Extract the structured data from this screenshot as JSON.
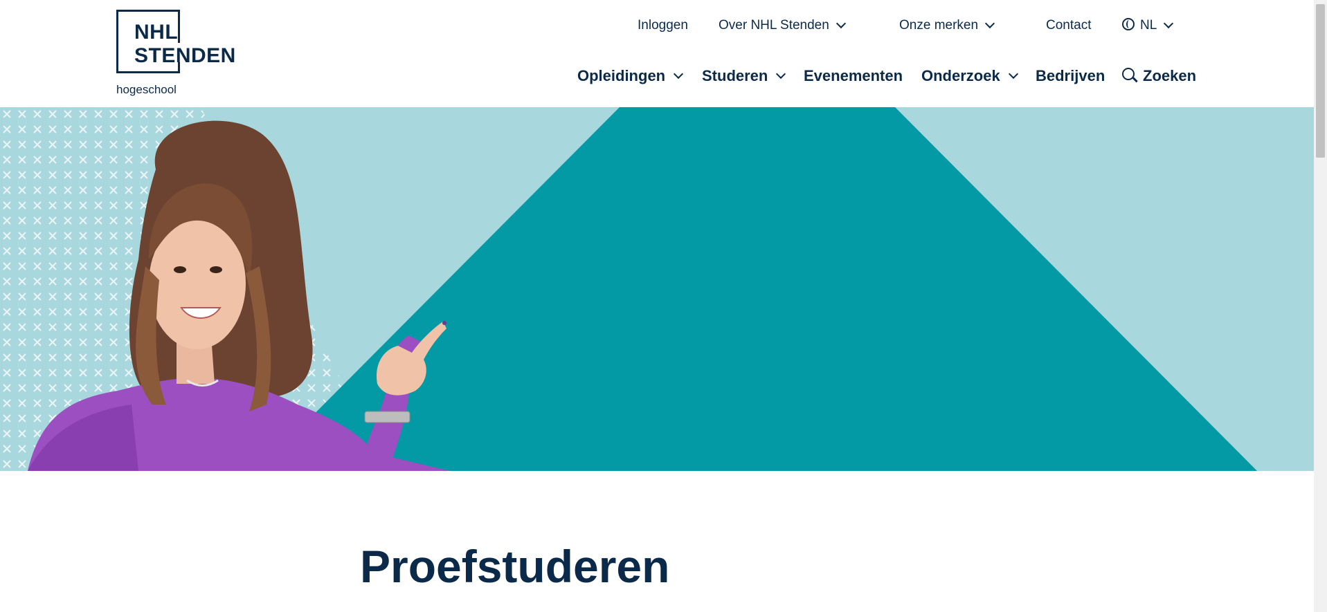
{
  "logo": {
    "line1": "NHL",
    "line2": "STENDEN",
    "sub": "hogeschool"
  },
  "topnav": {
    "login": "Inloggen",
    "about": "Over NHL Stenden",
    "brands": "Onze merken",
    "contact": "Contact",
    "language": "NL"
  },
  "mainnav": {
    "items": [
      {
        "label": "Opleidingen"
      },
      {
        "label": "Studeren"
      },
      {
        "label": "Evenementen"
      },
      {
        "label": "Onderzoek"
      },
      {
        "label": "Bedrijven"
      }
    ],
    "search": "Zoeken"
  },
  "content": {
    "title": "Proefstuderen"
  },
  "colors": {
    "navy": "#0b2a4a",
    "teal": "#039aa6",
    "light_teal": "#a9d7de",
    "purple": "#9b4fc0"
  }
}
